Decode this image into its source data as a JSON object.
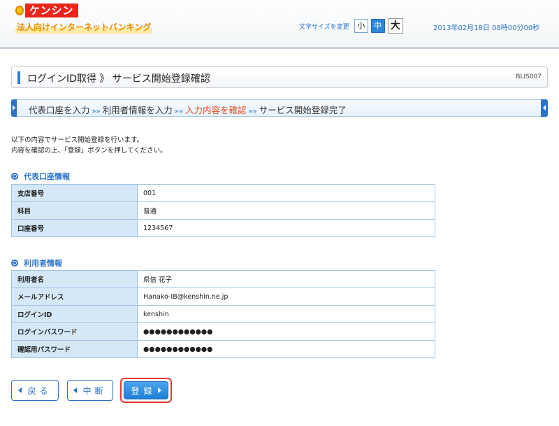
{
  "header": {
    "logo_text": "ケンシン",
    "service_name": "法人向けインターネットバンキング",
    "font_size_label": "文字サイズを変更",
    "font_sizes": [
      "小",
      "中",
      "大"
    ],
    "datetime": "2013年02月18日 08時00分00秒"
  },
  "title": {
    "text": "ログインID取得 》 サービス開始登録確認",
    "code": "BLIS007"
  },
  "steps": [
    "代表口座を入力",
    "利用者情報を入力",
    "入力内容を確認",
    "サービス開始登録完了"
  ],
  "steps_separator": "»»",
  "message": {
    "line1": "以下の内容でサービス開始登録を行います。",
    "line2": "内容を確認の上、「登録」ボタンを押してください。"
  },
  "account_section": {
    "title": "代表口座情報",
    "rows": [
      {
        "label": "支店番号",
        "value": "001"
      },
      {
        "label": "科目",
        "value": "普通"
      },
      {
        "label": "口座番号",
        "value": "1234567"
      }
    ]
  },
  "user_section": {
    "title": "利用者情報",
    "rows": [
      {
        "label": "利用者名",
        "value": "県信 花子"
      },
      {
        "label": "メールアドレス",
        "value": "Hanako-IB@kenshin.ne.jp"
      },
      {
        "label": "ログインID",
        "value": "kenshin"
      },
      {
        "label": "ログインパスワード",
        "value": "●●●●●●●●●●●●"
      },
      {
        "label": "確認用パスワード",
        "value": "●●●●●●●●●●●●"
      }
    ]
  },
  "buttons": {
    "back": "戻る",
    "cancel": "中断",
    "register": "登録"
  }
}
